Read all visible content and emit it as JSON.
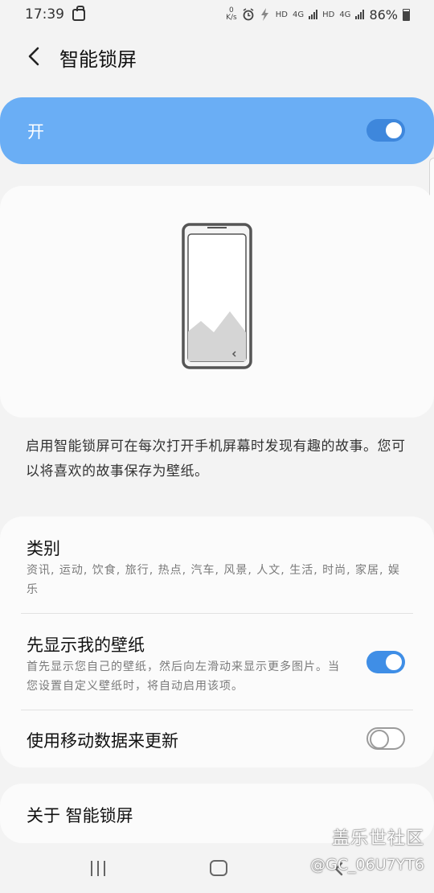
{
  "status_bar": {
    "time": "17:39",
    "speed_value": "0",
    "speed_unit": "K/s",
    "hd1": "HD",
    "net1": "4G",
    "hd2": "HD",
    "net2": "4G",
    "battery": "86%"
  },
  "header": {
    "title": "智能锁屏"
  },
  "master_switch": {
    "label": "开",
    "state": "on"
  },
  "description": "启用智能锁屏可在每次打开手机屏幕时发现有趣的故事。您可以将喜欢的故事保存为壁纸。",
  "settings": {
    "category": {
      "title": "类别",
      "summary": "资讯, 运动, 饮食, 旅行, 热点, 汽车, 风景, 人文, 生活, 时尚, 家居, 娱乐"
    },
    "my_wallpaper_first": {
      "title": "先显示我的壁纸",
      "summary": "首先显示您自己的壁纸，然后向左滑动来显示更多图片。当您设置自定义壁纸时，将自动启用该项。",
      "state": "on"
    },
    "mobile_data": {
      "title": "使用移动数据来更新",
      "state": "off"
    }
  },
  "about": {
    "label": "关于 智能锁屏"
  },
  "watermark": {
    "line1": "盖乐世社区",
    "line2": "@GC_06U7YT6"
  },
  "colors": {
    "accent": "#3f8ee6",
    "master_bg": "#6aaef5"
  }
}
